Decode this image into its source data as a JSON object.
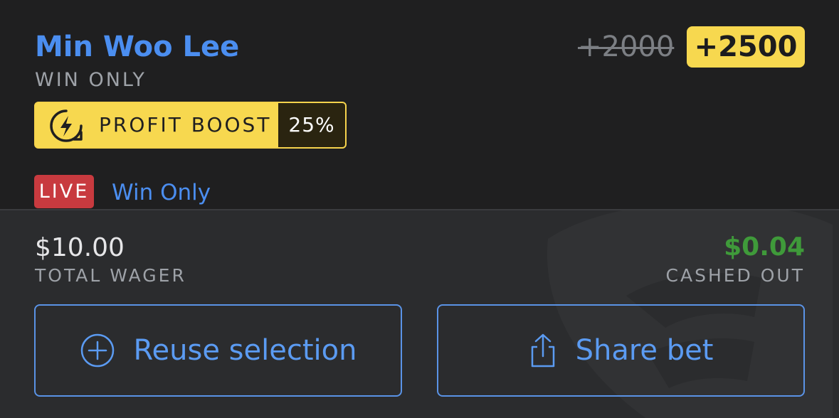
{
  "selection": {
    "player_name": "Min Woo Lee",
    "market_type": "WIN ONLY",
    "original_odds": "+2000",
    "boosted_odds": "+2500"
  },
  "boost": {
    "icon": "lightning-boost-icon",
    "label": "PROFIT BOOST",
    "percent": "25%"
  },
  "status": {
    "live_label": "LIVE",
    "market_name": "Win Only"
  },
  "wager": {
    "amount": "$10.00",
    "label": "TOTAL WAGER"
  },
  "cashout": {
    "amount": "$0.04",
    "label": "CASHED OUT"
  },
  "actions": {
    "reuse_label": "Reuse selection",
    "reuse_icon": "plus-circle-icon",
    "share_label": "Share bet",
    "share_icon": "share-icon"
  },
  "colors": {
    "accent_blue": "#4b8ef0",
    "boost_yellow": "#f7d84f",
    "live_red": "#c83a3f",
    "cashout_green": "#3f9a3a"
  }
}
